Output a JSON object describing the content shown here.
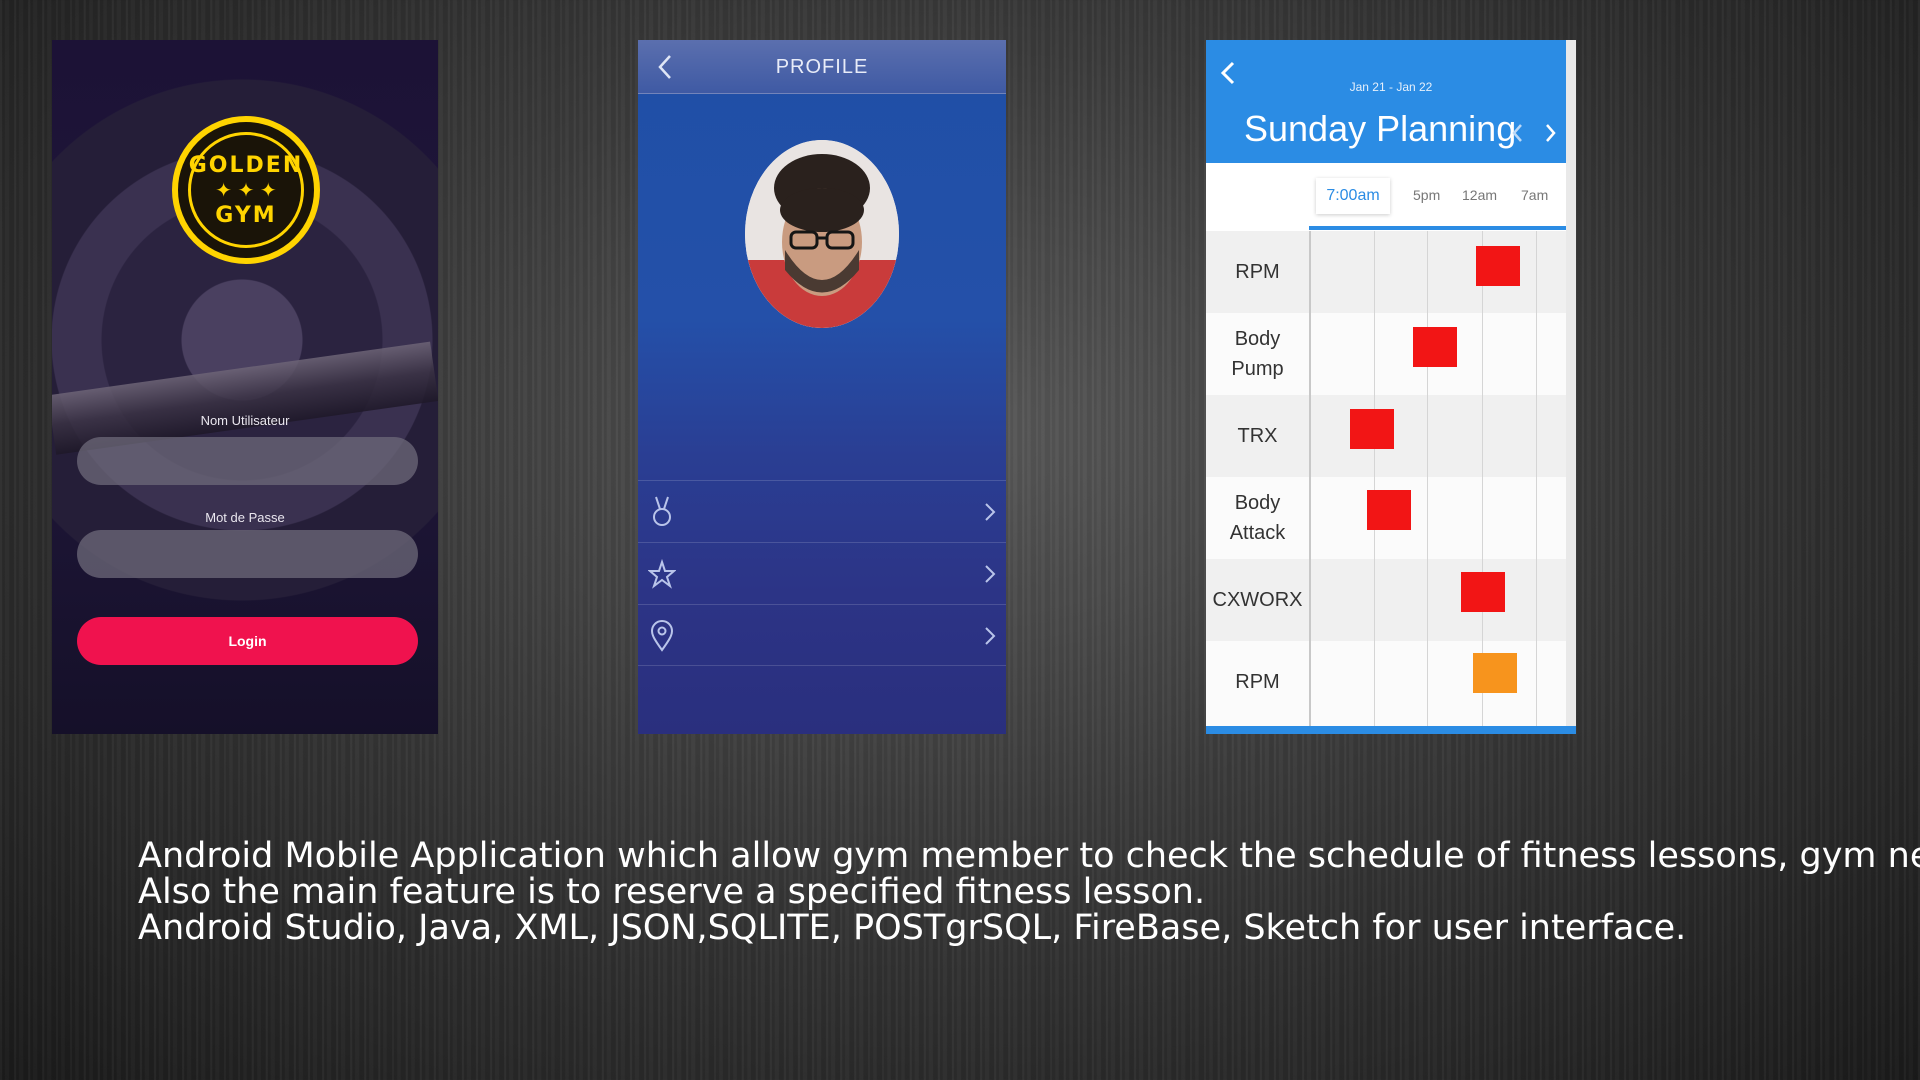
{
  "login": {
    "logo_text_top": "GOLDEN",
    "logo_text_bottom": "GYM",
    "username_label": "Nom Utilisateur",
    "password_label": "Mot de Passe",
    "login_button": "Login",
    "colors": {
      "button": "#f0124e",
      "logo": "#ffd400"
    }
  },
  "profile": {
    "title": "PROFILE",
    "rows": [
      {
        "icon": "medal-icon"
      },
      {
        "icon": "star-icon"
      },
      {
        "icon": "location-pin-icon"
      }
    ]
  },
  "planning": {
    "date_range": "Jan 21 - Jan 22",
    "title": "Sunday Planning",
    "times": [
      "7:00am",
      "5pm",
      "12am",
      "7am"
    ],
    "classes": [
      {
        "name": "RPM",
        "color": "#f21515"
      },
      {
        "name": "Body\nPump",
        "color": "#f21515"
      },
      {
        "name": "TRX",
        "color": "#f21515"
      },
      {
        "name": "Body\nAttack",
        "color": "#f21515"
      },
      {
        "name": "CXWORX",
        "color": "#f21515"
      },
      {
        "name": "RPM",
        "color": "#f7941d"
      }
    ],
    "accent_color": "#2b8ce4"
  },
  "description": {
    "line1": "Android Mobile Application which allow gym member to  check  the schedule of fitness lessons, gym news.",
    "line2": "Also the main feature is to reserve a specified fitness lesson.",
    "line3": "Android Studio, Java, XML, JSON,SQLITE, POSTgrSQL, FireBase, Sketch for user interface."
  }
}
